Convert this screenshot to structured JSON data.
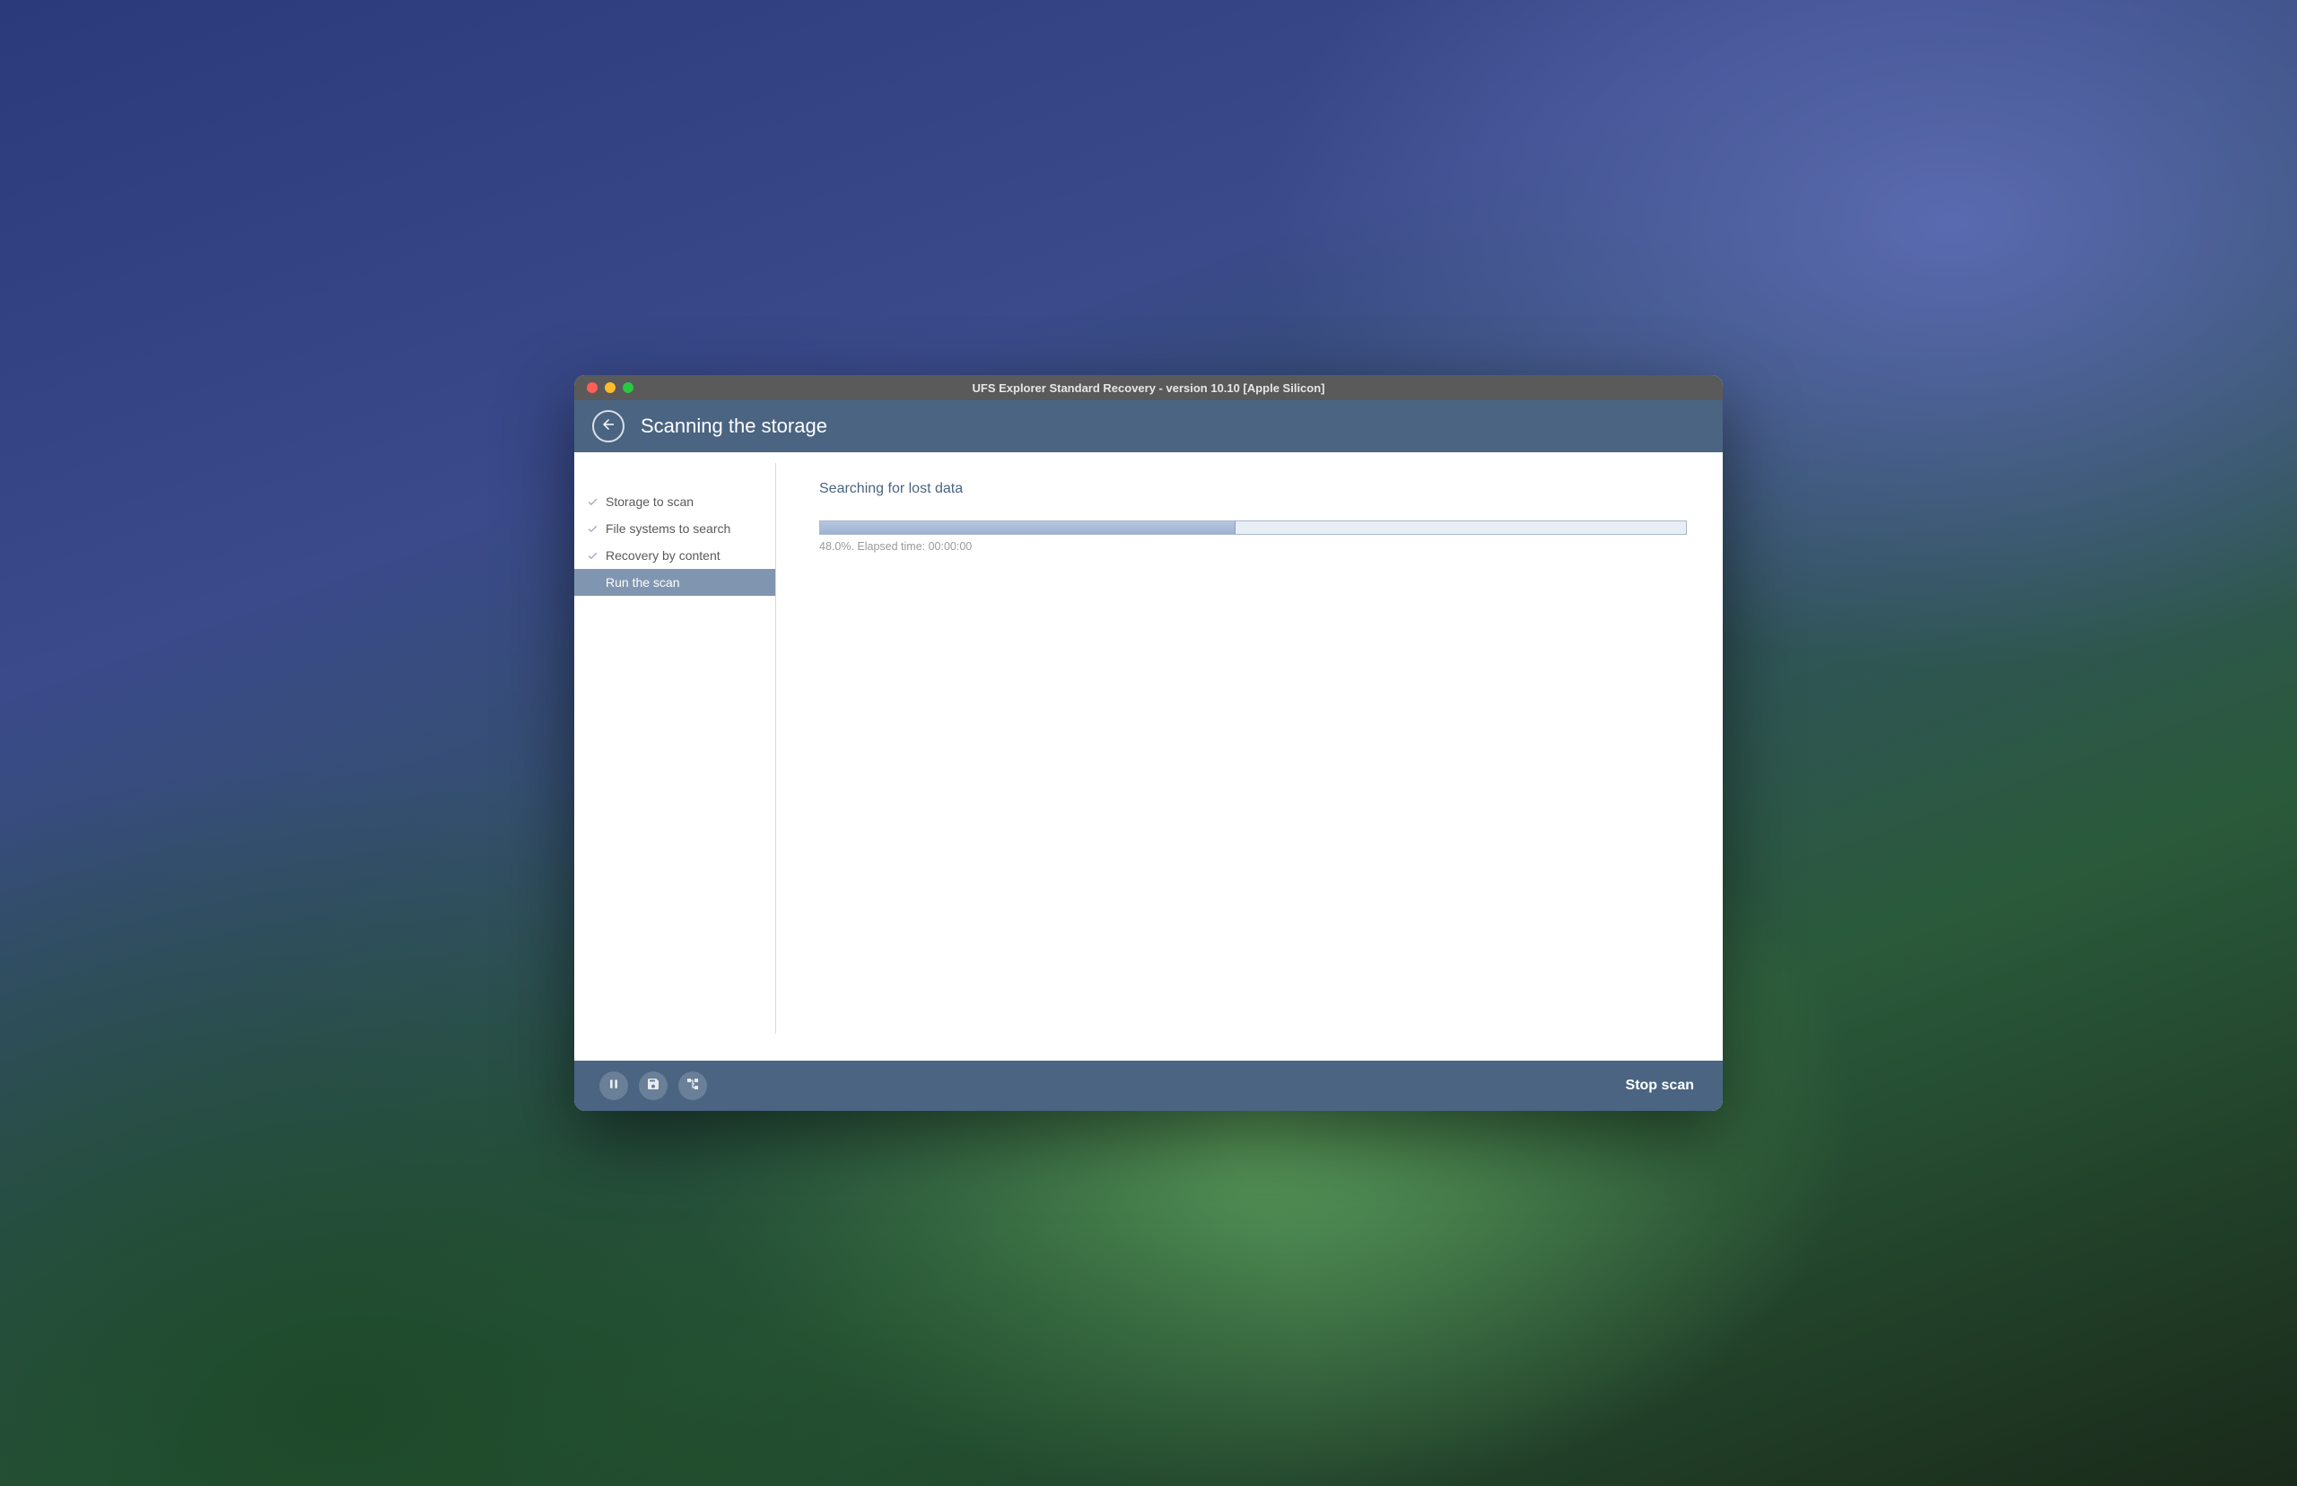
{
  "window": {
    "title": "UFS Explorer Standard Recovery - version 10.10 [Apple Silicon]"
  },
  "header": {
    "title": "Scanning the storage"
  },
  "sidebar": {
    "steps": [
      {
        "label": "Storage to scan",
        "done": true,
        "active": false
      },
      {
        "label": "File systems to search",
        "done": true,
        "active": false
      },
      {
        "label": "Recovery by content",
        "done": true,
        "active": false
      },
      {
        "label": "Run the scan",
        "done": false,
        "active": true
      }
    ]
  },
  "main": {
    "title": "Searching for lost data",
    "progress_percent": 48.0,
    "elapsed_time": "00:00:00",
    "progress_label": "48.0%. Elapsed time: 00:00:00"
  },
  "footer": {
    "pause_label": "Pause",
    "save_label": "Save",
    "tree_label": "Tree",
    "stop_label": "Stop scan"
  }
}
